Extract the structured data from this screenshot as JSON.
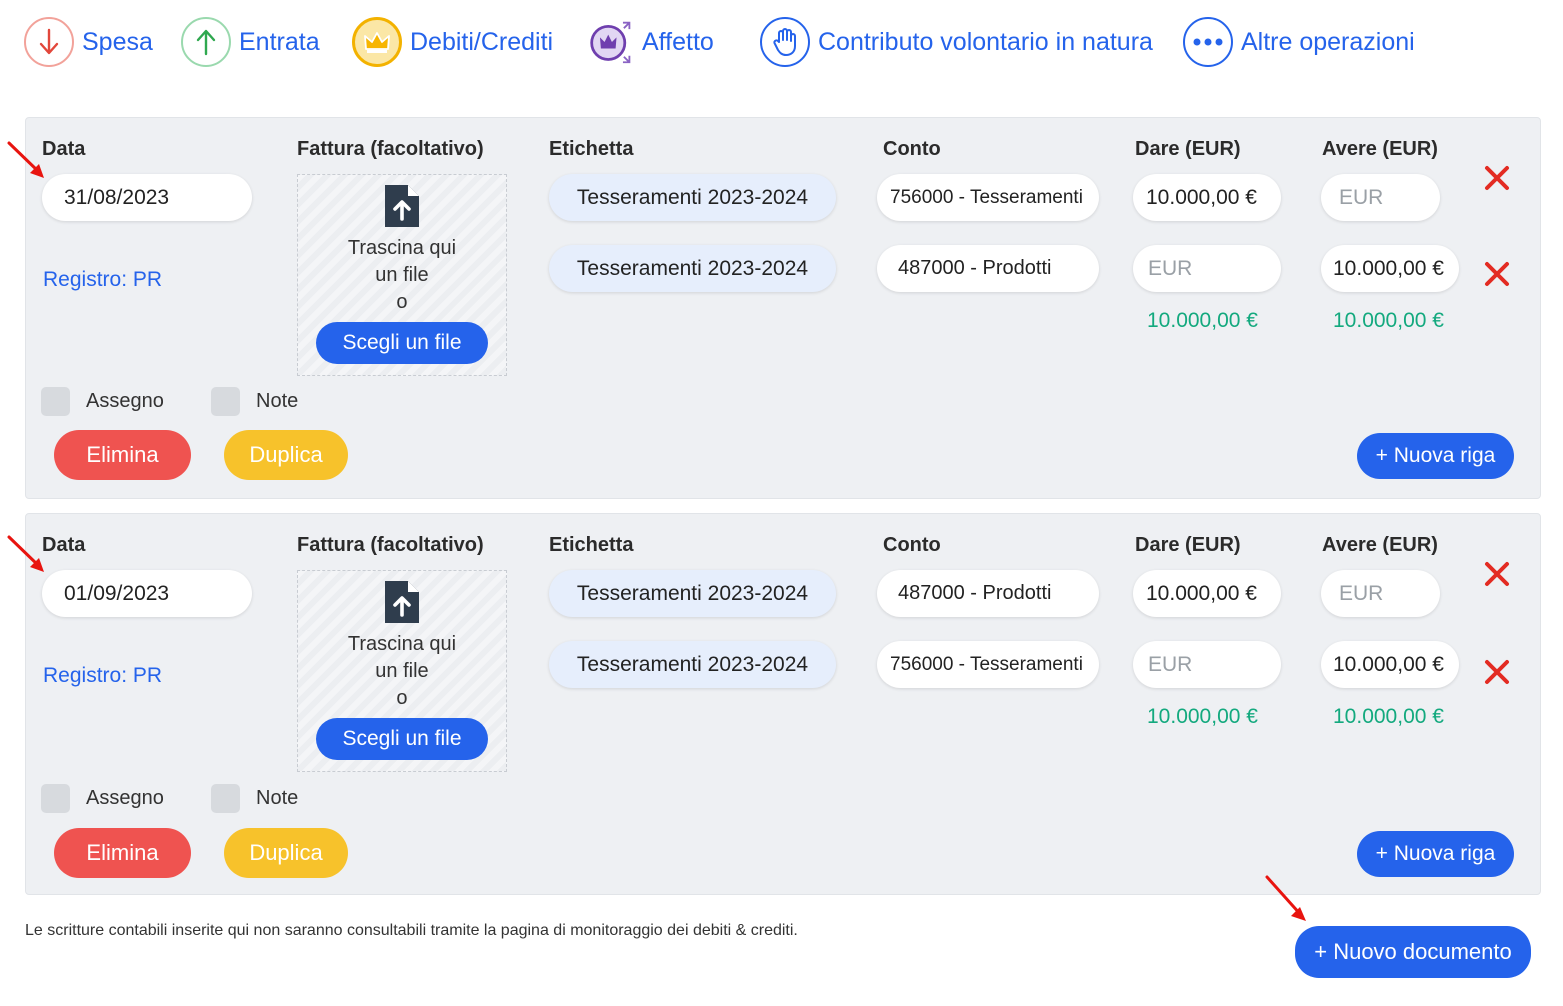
{
  "operations": [
    {
      "label": "Spesa",
      "icon": "arrow-down-icon"
    },
    {
      "label": "Entrata",
      "icon": "arrow-up-icon"
    },
    {
      "label": "Debiti/Crediti",
      "icon": "crown-icon"
    },
    {
      "label": "Affetto",
      "icon": "crown-expand-icon"
    },
    {
      "label": "Contributo volontario in natura",
      "icon": "hand-icon"
    },
    {
      "label": "Altre operazioni",
      "icon": "more-dots-icon"
    }
  ],
  "headers": {
    "data": "Data",
    "fattura": "Fattura (facoltativo)",
    "etichetta": "Etichetta",
    "conto": "Conto",
    "dare": "Dare (EUR)",
    "avere": "Avere (EUR)"
  },
  "dropzone": {
    "line1": "Trascina qui",
    "line2": "un file",
    "line3": "o",
    "button": "Scegli un file"
  },
  "checkboxes": {
    "assegno": "Assegno",
    "note": "Note"
  },
  "buttons": {
    "elimina": "Elimina",
    "duplica": "Duplica",
    "nuova_riga": "+ Nuova riga",
    "nuovo_documento": "+ Nuovo documento"
  },
  "documents": [
    {
      "date": "31/08/2023",
      "registro": "Registro: PR",
      "rows": [
        {
          "etichetta": "Tesseramenti 2023-2024",
          "conto": "756000 - Tesseramenti",
          "dare": "10.000,00 €",
          "avere": ""
        },
        {
          "etichetta": "Tesseramenti 2023-2024",
          "conto": "487000 - Prodotti",
          "dare": "",
          "avere": "10.000,00 €"
        }
      ],
      "total_dare": "10.000,00 €",
      "total_avere": "10.000,00 €"
    },
    {
      "date": "01/09/2023",
      "registro": "Registro: PR",
      "rows": [
        {
          "etichetta": "Tesseramenti 2023-2024",
          "conto": "487000 - Prodotti",
          "dare": "10.000,00 €",
          "avere": ""
        },
        {
          "etichetta": "Tesseramenti 2023-2024",
          "conto": "756000 - Tesseramenti",
          "dare": "",
          "avere": "10.000,00 €"
        }
      ],
      "total_dare": "10.000,00 €",
      "total_avere": "10.000,00 €"
    }
  ],
  "amount_placeholder": "EUR",
  "footnote": "Le scritture contabili inserite qui non saranno consultabili tramite la pagina di monitoraggio dei debiti & crediti.",
  "colors": {
    "link_blue": "#2563eb",
    "danger_red": "#ef5350",
    "warning_yellow": "#f7c22b",
    "total_green": "#13a97e",
    "tag_bg": "#e6eefc"
  }
}
